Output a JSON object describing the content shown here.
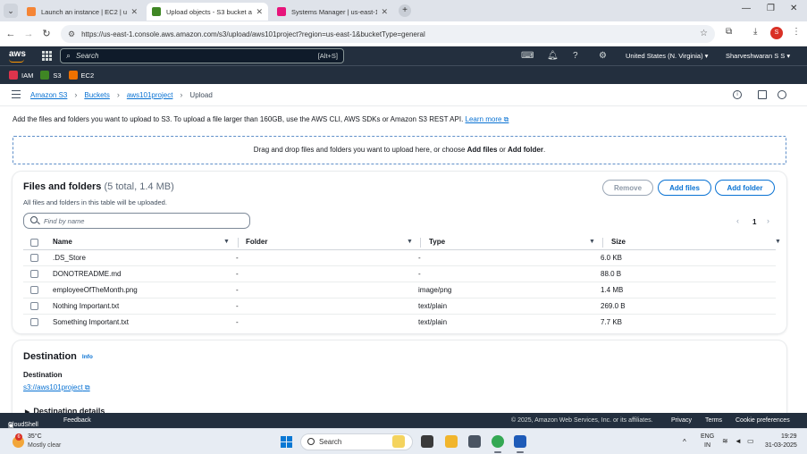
{
  "browser": {
    "tabs": [
      {
        "label": "Launch an instance | EC2 | us-e",
        "favicon_color": "#f58536"
      },
      {
        "label": "Upload objects - S3 bucket aws",
        "favicon_color": "#3f8624"
      },
      {
        "label": "Systems Manager | us-east-1",
        "favicon_color": "#e7157b"
      }
    ],
    "url": "https://us-east-1.console.aws.amazon.com/s3/upload/aws101project?region=us-east-1&bucketType=general",
    "profile_initial": "S"
  },
  "aws_nav": {
    "logo": "aws",
    "search_placeholder": "Search",
    "search_shortcut": "[Alt+S]",
    "region": "United States (N. Virginia)",
    "account": "Sharveshwaran S S"
  },
  "favorites": [
    {
      "label": "IAM",
      "icon": "iam-icon",
      "color": "#dd344c"
    },
    {
      "label": "S3",
      "icon": "s3-icon",
      "color": "#3f8624"
    },
    {
      "label": "EC2",
      "icon": "ec2-icon",
      "color": "#ed7100"
    }
  ],
  "breadcrumb": {
    "items": [
      "Amazon S3",
      "Buckets",
      "aws101project"
    ],
    "current": "Upload"
  },
  "intro": {
    "text": "Add the files and folders you want to upload to S3. To upload a file larger than 160GB, use the AWS CLI, AWS SDKs or Amazon S3 REST API.",
    "link": "Learn more"
  },
  "dropzone": {
    "prefix": "Drag and drop files and folders you want to upload here, or choose ",
    "add_files": "Add files",
    "middle": " or ",
    "add_folder": "Add folder",
    "suffix": "."
  },
  "files_panel": {
    "title": "Files and folders",
    "count": "(5 total, 1.4 MB)",
    "description": "All files and folders in this table will be uploaded.",
    "buttons": {
      "remove": "Remove",
      "add_files": "Add files",
      "add_folder": "Add folder"
    },
    "filter_placeholder": "Find by name",
    "page": "1",
    "columns": [
      "Name",
      "Folder",
      "Type",
      "Size"
    ],
    "rows": [
      {
        "name": ".DS_Store",
        "folder": "-",
        "type": "-",
        "size": "6.0 KB"
      },
      {
        "name": "DONOTREADME.md",
        "folder": "-",
        "type": "-",
        "size": "88.0 B"
      },
      {
        "name": "employeeOfTheMonth.png",
        "folder": "-",
        "type": "image/png",
        "size": "1.4 MB"
      },
      {
        "name": "Nothing Important.txt",
        "folder": "-",
        "type": "text/plain",
        "size": "269.0 B"
      },
      {
        "name": "Something Important.txt",
        "folder": "-",
        "type": "text/plain",
        "size": "7.7 KB"
      }
    ]
  },
  "destination": {
    "title": "Destination",
    "info": "Info",
    "label": "Destination",
    "link": "s3://aws101project",
    "details": "Destination details"
  },
  "footer": {
    "cloudshell": "CloudShell",
    "feedback": "Feedback",
    "copyright": "© 2025, Amazon Web Services, Inc. or its affiliates.",
    "privacy": "Privacy",
    "terms": "Terms",
    "cookies": "Cookie preferences"
  },
  "taskbar": {
    "weather_badge": "6",
    "temperature": "35°C",
    "condition": "Mostly clear",
    "search": "Search",
    "lang1": "ENG",
    "lang2": "IN",
    "time": "19:29",
    "date": "31-03-2025"
  }
}
